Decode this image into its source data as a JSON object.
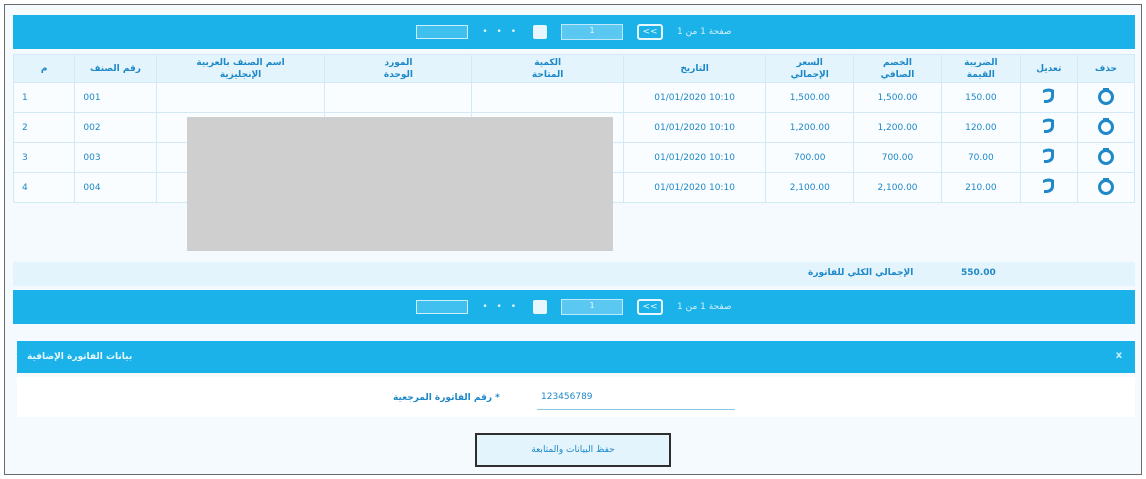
{
  "pager": {
    "label": "صفحة 1 من 1",
    "nav_prev": "<<",
    "page_select": "1",
    "jump_dots": "• • •",
    "go_input": ""
  },
  "grid": {
    "columns": [
      {
        "l1": "م",
        "l2": ""
      },
      {
        "l1": "رقم الصنف",
        "l2": ""
      },
      {
        "l1": "اسم الصنف بالعربية",
        "l2": "الإنجليزية"
      },
      {
        "l1": "المورد",
        "l2": "الوحدة"
      },
      {
        "l1": "الكمية",
        "l2": "المتاحة"
      },
      {
        "l1": "التاريخ",
        "l2": ""
      },
      {
        "l1": "السعر",
        "l2": "الإجمالي"
      },
      {
        "l1": "الخصم",
        "l2": "الصافي"
      },
      {
        "l1": "الضريبة",
        "l2": "القيمة"
      },
      {
        "l1": "تعديل",
        "l2": ""
      },
      {
        "l1": "حذف",
        "l2": ""
      }
    ],
    "rows": [
      {
        "num": "1",
        "code": "001",
        "date": "01/01/2020 10:10",
        "price": "1,500.00",
        "discount": "1,500.00",
        "tax": "150.00"
      },
      {
        "num": "2",
        "code": "002",
        "date": "01/01/2020 10:10",
        "price": "1,200.00",
        "discount": "1,200.00",
        "tax": "120.00"
      },
      {
        "num": "3",
        "code": "003",
        "date": "01/01/2020 10:10",
        "price": "700.00",
        "discount": "700.00",
        "tax": "70.00"
      },
      {
        "num": "4",
        "code": "004",
        "date": "01/01/2020 10:10",
        "price": "2,100.00",
        "discount": "2,100.00",
        "tax": "210.00"
      }
    ]
  },
  "summary": {
    "label": "الإجمالي الكلي للفاتورة",
    "value": "550.00"
  },
  "panel": {
    "title": "بيانات الفاتورة الإضافية",
    "close_icon": "x",
    "field_label": "رقم الفاتورة المرجعية *",
    "field_value": "123456789",
    "submit_label": "حفظ البيانات والمتابعة"
  },
  "colors": {
    "accent": "#1ab2e8",
    "text": "#1e88c8",
    "header_bg": "#e3f4fc",
    "masked": "#cfcfcf"
  }
}
